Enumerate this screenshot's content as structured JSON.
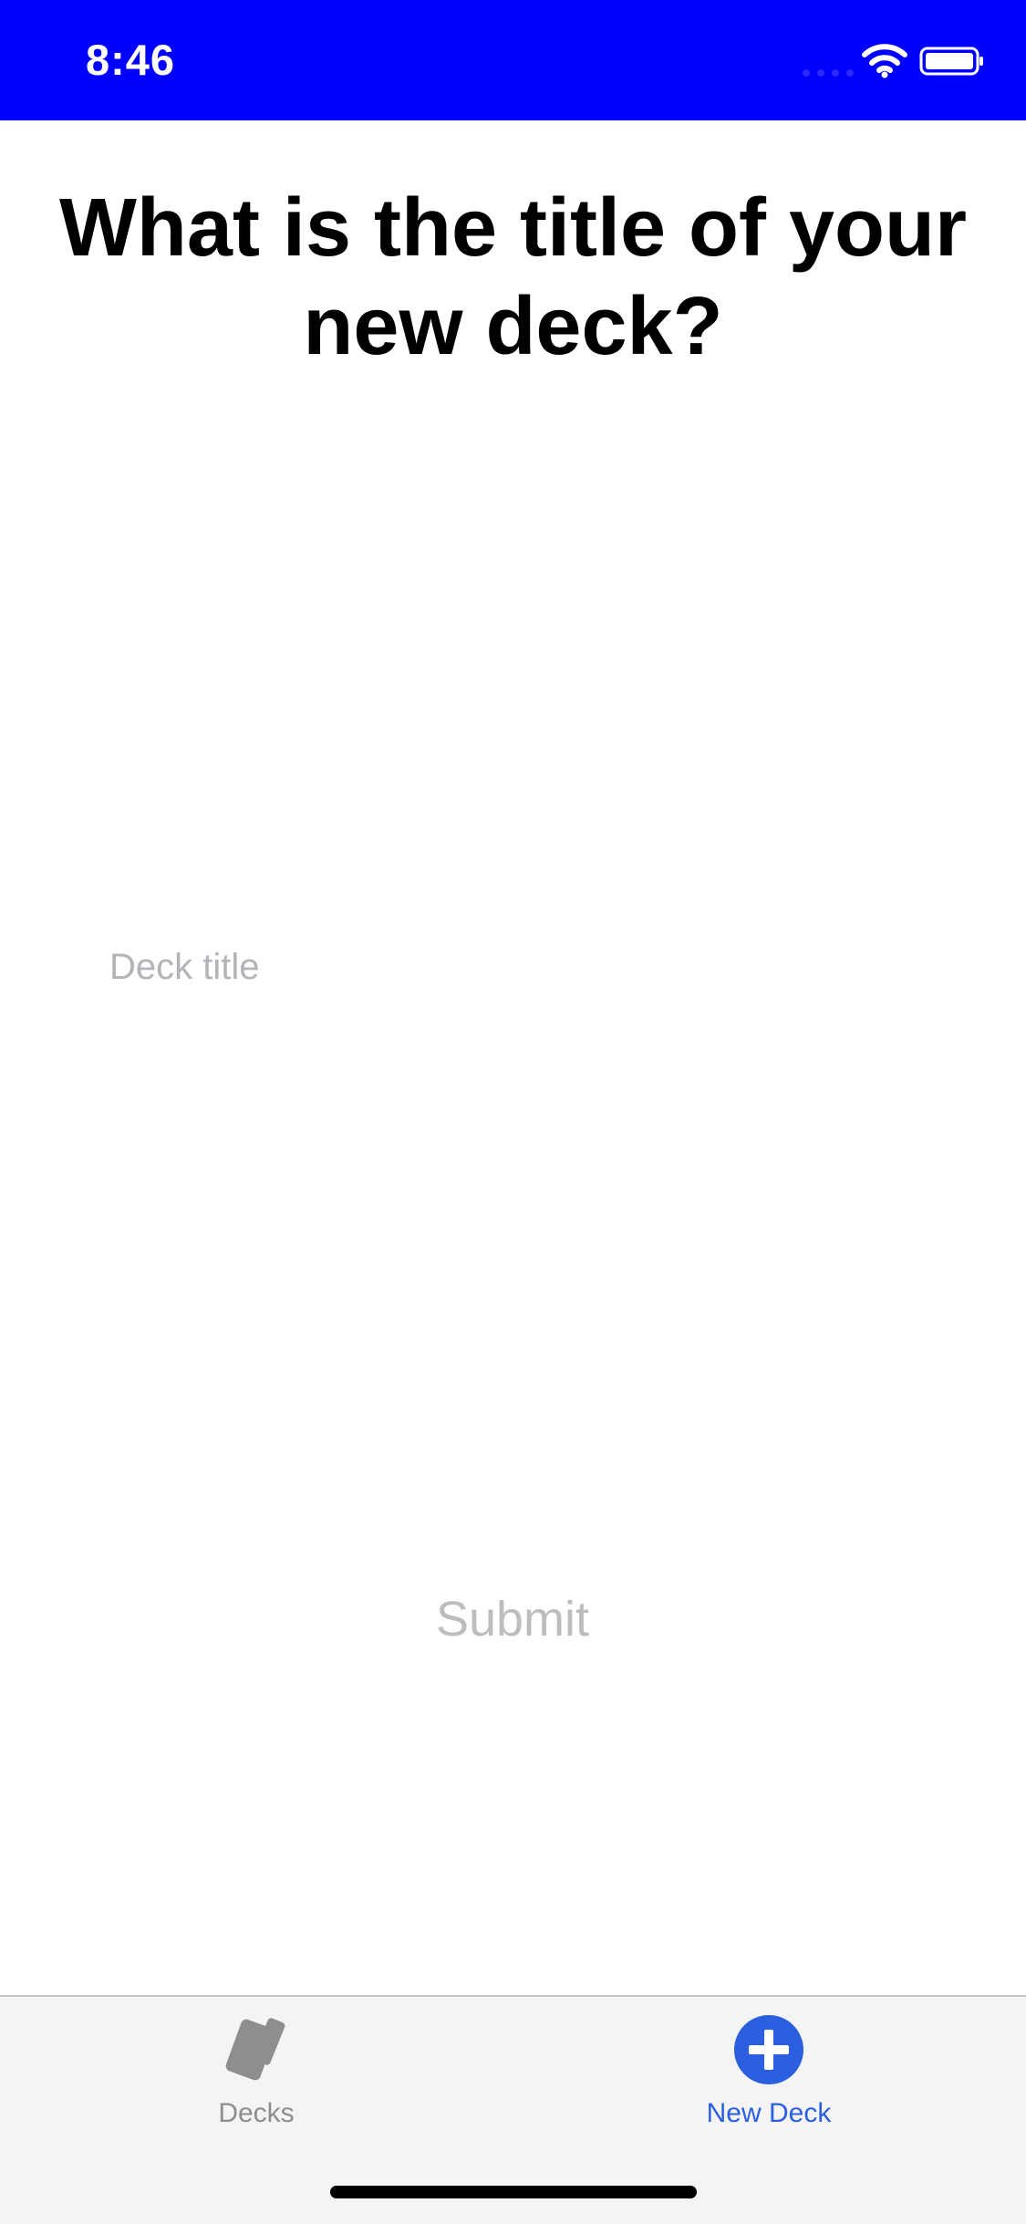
{
  "status_bar": {
    "time": "8:46",
    "background_color": "#0000ff",
    "icons": [
      "signal-icon",
      "wifi-icon",
      "battery-icon"
    ]
  },
  "page": {
    "title": "What is the title of your new deck?"
  },
  "form": {
    "deck_title_value": "",
    "deck_title_placeholder": "Deck title",
    "submit_label": "Submit"
  },
  "tab_bar": {
    "items": [
      {
        "label": "Decks",
        "icon": "cards-icon",
        "active": false,
        "color": "#8e8e8e"
      },
      {
        "label": "New Deck",
        "icon": "plus-circle-icon",
        "active": true,
        "color": "#2b5fe0"
      }
    ]
  }
}
